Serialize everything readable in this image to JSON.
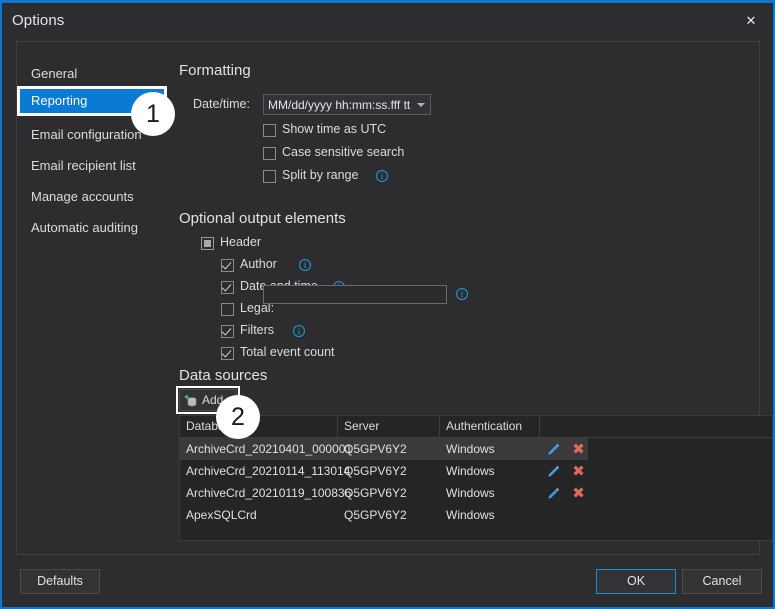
{
  "window": {
    "title": "Options",
    "close_icon": "close-icon",
    "accent_color": "#1177cc",
    "background": "#2d2d30"
  },
  "sidebar": {
    "items": [
      {
        "label": "General",
        "selected": false
      },
      {
        "label": "Reporting",
        "selected": true
      },
      {
        "label": "Email configuration",
        "selected": false
      },
      {
        "label": "Email recipient list",
        "selected": false
      },
      {
        "label": "Manage accounts",
        "selected": false
      },
      {
        "label": "Automatic auditing",
        "selected": false
      }
    ],
    "selected_color": "#0a7bd4"
  },
  "formatting": {
    "heading": "Formatting",
    "datetime_label": "Date/time:",
    "datetime_value": "MM/dd/yyyy hh:mm:ss.fff tt",
    "options": [
      {
        "label": "Show time as UTC",
        "checked": false,
        "info": false
      },
      {
        "label": "Case sensitive search",
        "checked": false,
        "info": false
      },
      {
        "label": "Split by range",
        "checked": false,
        "info": true
      }
    ]
  },
  "optional_output": {
    "heading": "Optional output elements",
    "header": {
      "label": "Header",
      "state": "indeterminate"
    },
    "children": [
      {
        "label": "Author",
        "checked": true,
        "info": true,
        "input": false
      },
      {
        "label": "Date and time",
        "checked": true,
        "info": true,
        "input": false
      },
      {
        "label": "Legal:",
        "checked": false,
        "info": true,
        "input": true,
        "input_value": ""
      },
      {
        "label": "Filters",
        "checked": true,
        "info": true,
        "input": false
      },
      {
        "label": "Total event count",
        "checked": true,
        "info": false,
        "input": false
      }
    ]
  },
  "data_sources": {
    "heading": "Data sources",
    "add_label": "Add",
    "add_icon": "database-add-icon",
    "columns": [
      "Database",
      "Server",
      "Authentication",
      ""
    ],
    "rows": [
      {
        "database": "ArchiveCrd_20210401_000001",
        "server": "Q5GPV6Y2",
        "authentication": "Windows",
        "actions": true,
        "selected": true
      },
      {
        "database": "ArchiveCrd_20210114_113014",
        "server": "Q5GPV6Y2",
        "authentication": "Windows",
        "actions": true,
        "selected": false
      },
      {
        "database": "ArchiveCrd_20210119_100836",
        "server": "Q5GPV6Y2",
        "authentication": "Windows",
        "actions": true,
        "selected": false
      },
      {
        "database": "ApexSQLCrd",
        "server": "Q5GPV6Y2",
        "authentication": "Windows",
        "actions": false,
        "selected": false
      }
    ],
    "edit_icon": "pencil-icon",
    "delete_icon": "delete-x-icon"
  },
  "footer": {
    "defaults_label": "Defaults",
    "ok_label": "OK",
    "cancel_label": "Cancel"
  },
  "callouts": [
    {
      "number": "1"
    },
    {
      "number": "2"
    }
  ]
}
